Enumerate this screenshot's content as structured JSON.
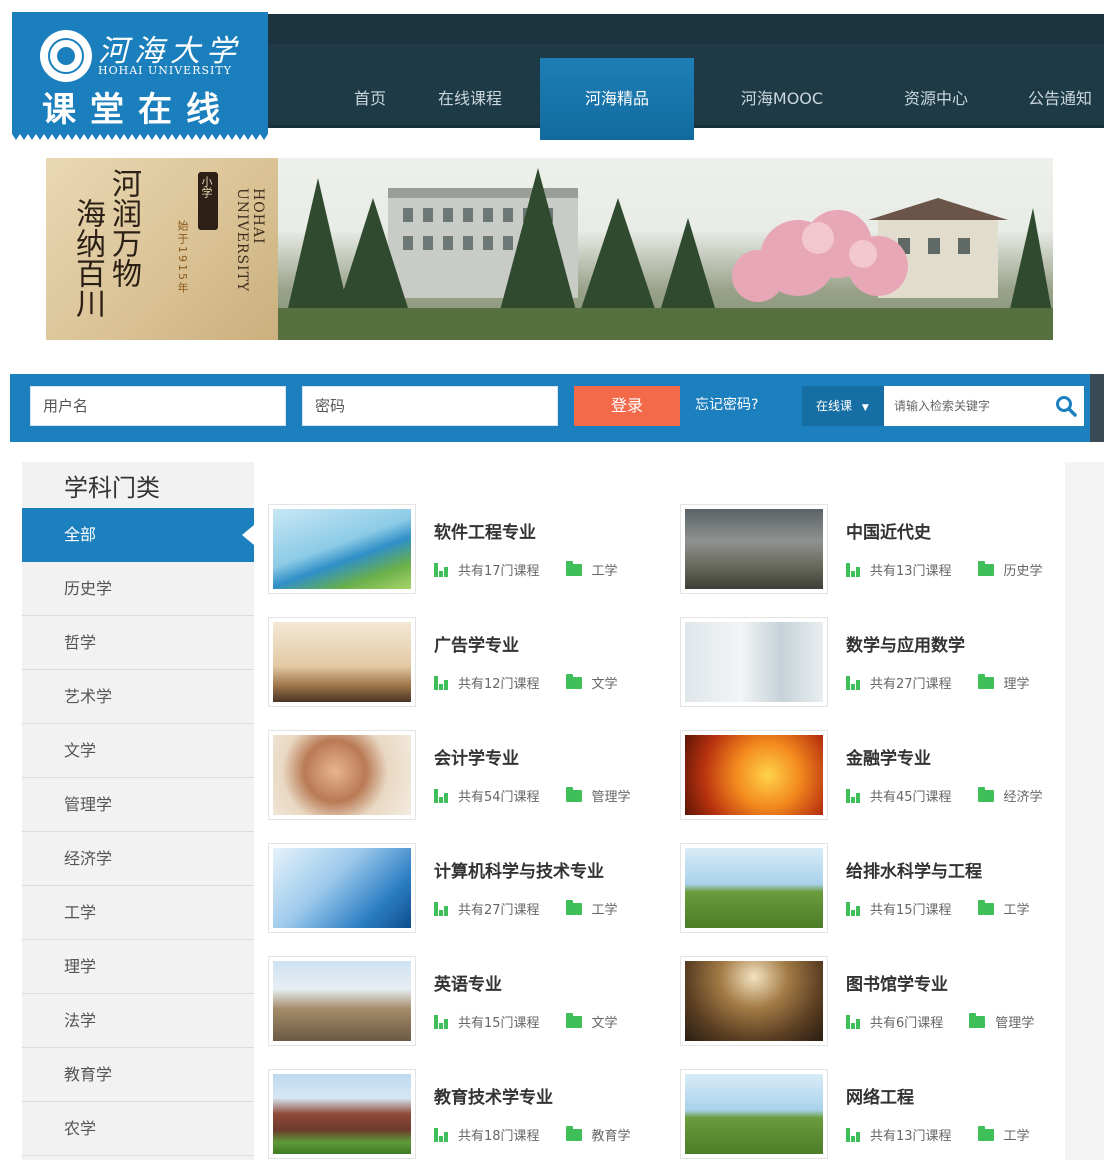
{
  "header": {
    "logo": {
      "name_cn": "河海大学",
      "name_en": "HOHAI UNIVERSITY",
      "slogan": "课堂在线"
    },
    "nav": [
      {
        "label": "首页",
        "active": false
      },
      {
        "label": "在线课程",
        "active": false
      },
      {
        "label": "河海精品",
        "active": true
      },
      {
        "label": "河海MOOC",
        "active": false
      },
      {
        "label": "资源中心",
        "active": false
      },
      {
        "label": "公告通知",
        "active": false
      }
    ]
  },
  "banner": {
    "motto_1": "河润万物",
    "motto_2": "海纳百川",
    "seal": "小学",
    "since": "始于1915年",
    "university_en": "HOHAI UNIVERSITY"
  },
  "login": {
    "username_placeholder": "用户名",
    "password_placeholder": "密码",
    "login_button": "登录",
    "forgot_link": "忘记密码?",
    "search_type": "在线课",
    "search_placeholder": "请输入检索关键字"
  },
  "sidebar": {
    "title": "学科门类",
    "categories": [
      {
        "label": "全部",
        "active": true
      },
      {
        "label": "历史学",
        "active": false
      },
      {
        "label": "哲学",
        "active": false
      },
      {
        "label": "艺术学",
        "active": false
      },
      {
        "label": "文学",
        "active": false
      },
      {
        "label": "管理学",
        "active": false
      },
      {
        "label": "经济学",
        "active": false
      },
      {
        "label": "工学",
        "active": false
      },
      {
        "label": "理学",
        "active": false
      },
      {
        "label": "法学",
        "active": false
      },
      {
        "label": "教育学",
        "active": false
      },
      {
        "label": "农学",
        "active": false
      }
    ]
  },
  "majors": [
    {
      "name": "软件工程专业",
      "count": "共有17门课程",
      "discipline": "工学"
    },
    {
      "name": "中国近代史",
      "count": "共有13门课程",
      "discipline": "历史学"
    },
    {
      "name": "广告学专业",
      "count": "共有12门课程",
      "discipline": "文学"
    },
    {
      "name": "数学与应用数学",
      "count": "共有27门课程",
      "discipline": "理学"
    },
    {
      "name": "会计学专业",
      "count": "共有54门课程",
      "discipline": "管理学"
    },
    {
      "name": "金融学专业",
      "count": "共有45门课程",
      "discipline": "经济学"
    },
    {
      "name": "计算机科学与技术专业",
      "count": "共有27门课程",
      "discipline": "工学"
    },
    {
      "name": "给排水科学与工程",
      "count": "共有15门课程",
      "discipline": "工学"
    },
    {
      "name": "英语专业",
      "count": "共有15门课程",
      "discipline": "文学"
    },
    {
      "name": "图书馆学专业",
      "count": "共有6门课程",
      "discipline": "管理学"
    },
    {
      "name": "教育技术学专业",
      "count": "共有18门课程",
      "discipline": "教育学"
    },
    {
      "name": "网络工程",
      "count": "共有13门课程",
      "discipline": "工学"
    }
  ],
  "colors": {
    "brand_blue": "#1c7fbe",
    "nav_dark": "#1e3a47",
    "login_orange": "#f36a4b",
    "icon_green": "#3fbf5a"
  }
}
